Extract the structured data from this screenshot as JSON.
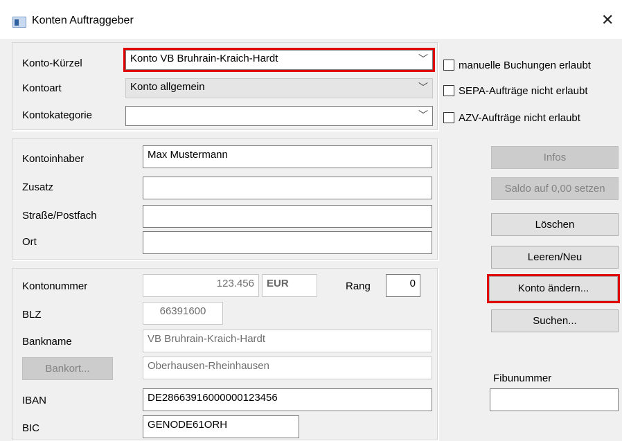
{
  "window": {
    "title": "Konten Auftraggeber",
    "close_glyph": "✕"
  },
  "top": {
    "konto_kuerzel_label": "Konto-Kürzel",
    "konto_kuerzel_value": "Konto VB Bruhrain-Kraich-Hardt",
    "kontoart_label": "Kontoart",
    "kontoart_value": "Konto allgemein",
    "kontokategorie_label": "Kontokategorie",
    "kontokategorie_value": "",
    "check_manuelle": "manuelle Buchungen erlaubt",
    "check_sepa": "SEPA-Aufträge nicht erlaubt",
    "check_azv": "AZV-Aufträge nicht erlaubt",
    "dropdown_glyph": "﹀"
  },
  "holder": {
    "kontoinhaber_label": "Kontoinhaber",
    "kontoinhaber_value": "Max Mustermann",
    "zusatz_label": "Zusatz",
    "zusatz_value": "",
    "strasse_label": "Straße/Postfach",
    "strasse_value": "",
    "ort_label": "Ort",
    "ort_value": ""
  },
  "bank": {
    "kontonummer_label": "Kontonummer",
    "kontonummer_value": "123.456",
    "currency": "EUR",
    "rang_label": "Rang",
    "rang_value": "0",
    "blz_label": "BLZ",
    "blz_value": "66391600",
    "bankname_label": "Bankname",
    "bankname_value": "VB Bruhrain-Kraich-Hardt",
    "bankort_button": "Bankort...",
    "bankort_value": "Oberhausen-Rheinhausen",
    "iban_label": "IBAN",
    "iban_value": "DE28663916000000123456",
    "bic_label": "BIC",
    "bic_value": "GENODE61ORH"
  },
  "buttons": {
    "infos": "Infos",
    "saldo": "Saldo auf 0,00 setzen",
    "loeschen": "Löschen",
    "leeren": "Leeren/Neu",
    "konto_aendern": "Konto ändern...",
    "suchen": "Suchen..."
  },
  "fibu": {
    "label": "Fibunummer",
    "value": ""
  },
  "colors": {
    "highlight": "#e00000",
    "dialog_bg": "#f0f0f0"
  }
}
